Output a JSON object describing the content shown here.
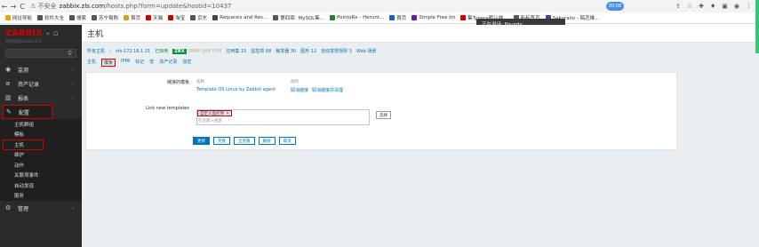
{
  "browser": {
    "back": "←",
    "forward": "→",
    "reload": "C",
    "insecure": "⚠ 不安全",
    "url_host": "zabbix.zls.com",
    "url_path": "/hosts.php?form=update&hostid=10437",
    "time_badge": "00:08",
    "right_icons": [
      "⇪",
      "☆",
      "✚",
      "♦",
      "▣",
      "◉",
      "⋮"
    ]
  },
  "bookmarks": [
    {
      "label": "网址导航",
      "color": "#f0a30a"
    },
    {
      "label": "软件大全",
      "color": "#555"
    },
    {
      "label": "搜索",
      "color": "#555"
    },
    {
      "label": "苏宁易购",
      "color": "#555"
    },
    {
      "label": "首页",
      "color": "#d4a017"
    },
    {
      "label": "天猫",
      "color": "#d40000"
    },
    {
      "label": "淘宝",
      "color": "#d40000"
    },
    {
      "label": "京东",
      "color": "#555"
    },
    {
      "label": "Requests and Res...",
      "color": "#444"
    },
    {
      "label": "第四章: MySQL集...",
      "color": "#555"
    },
    {
      "label": "PointsRx - Herunt...",
      "color": "#2e7d32"
    },
    {
      "label": "首页",
      "color": "#1565c0"
    },
    {
      "label": "Simple Free Im",
      "color": "#6a1b9a"
    },
    {
      "label": "集Typora默认样...",
      "color": "#d40000"
    },
    {
      "label": "新标签页",
      "color": "#555"
    },
    {
      "label": "Sakuraiio - 稿恋维...",
      "color": "#3949ab"
    }
  ],
  "overlay": {
    "text": "正在讲话: Pounds:"
  },
  "sidebar": {
    "logo": "ZABBIX",
    "collapse": "«",
    "expand": "⊡",
    "subtitle": "带你游向Zabbix5.0",
    "search_icon": "⚲",
    "items": [
      {
        "label": "监测",
        "icon": "eye-icon",
        "glyph": "◉"
      },
      {
        "label": "资产记录",
        "icon": "list-icon",
        "glyph": "≡"
      },
      {
        "label": "报表",
        "icon": "chart-icon",
        "glyph": "▥"
      },
      {
        "label": "配置",
        "icon": "wrench-icon",
        "glyph": "✎"
      }
    ],
    "submenu": [
      "主机群组",
      "模板",
      "主机",
      "维护",
      "动作",
      "关联项事件",
      "自动发现",
      "服务"
    ],
    "bottom": {
      "label": "管理",
      "icon": "gear-icon",
      "glyph": "⚙"
    }
  },
  "page": {
    "title": "主机",
    "breadcrumb": [
      "所有主机",
      "nfs-172.16.1.31",
      "已启用",
      "ZBX",
      "SNMP",
      "JMX",
      "IPMI",
      "应用集 15",
      "监控项 68",
      "触发器 30",
      "图形 12",
      "自动发现规则 3",
      "Web 场景"
    ],
    "tabs": [
      "主机",
      "模板",
      "IPMI",
      "标记",
      "宏",
      "资产记录",
      "加密"
    ],
    "linked_label": "链接的模板",
    "col_name": "名称",
    "col_action": "动作",
    "linked_template": "Template OS Linux by Zabbix agent",
    "unlink": "取消链接",
    "unlink_clear": "取消链接并清理",
    "link_new_label": "Link new templates",
    "chip": "自定义监控项",
    "chip_x": "✕",
    "placeholder": "在此输入搜索",
    "select": "选择",
    "buttons": [
      "更新",
      "克隆",
      "全克隆",
      "删除",
      "取消"
    ]
  }
}
